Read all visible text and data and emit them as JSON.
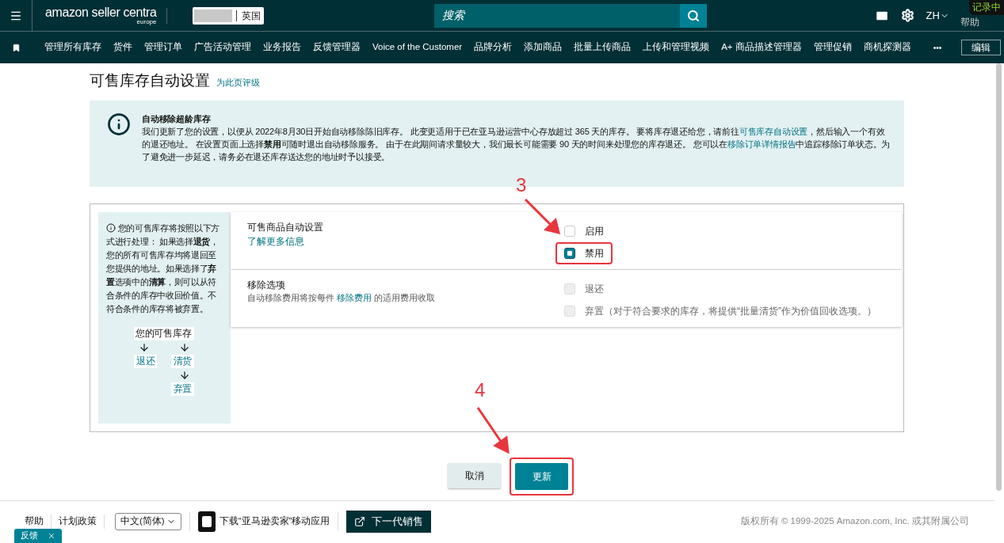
{
  "topbar": {
    "logo": {
      "name": "amazon seller centra",
      "region": "europe"
    },
    "marketplace": "英国",
    "search": {
      "placeholder": "搜索"
    },
    "language": "ZH",
    "help": "帮助",
    "recording_badge": "记录中"
  },
  "nav": {
    "items": [
      "管理所有库存",
      "货件",
      "管理订单",
      "广告活动管理",
      "业务报告",
      "反馈管理器",
      "Voice of the Customer",
      "品牌分析",
      "添加商品",
      "批量上传商品",
      "上传和管理视频",
      "A+ 商品描述管理器",
      "管理促销",
      "商机探测器"
    ],
    "more": "•••",
    "edit": "编辑"
  },
  "page": {
    "title": "可售库存自动设置",
    "rate_link": "为此页评级"
  },
  "banner": {
    "title": "自动移除超龄库存",
    "segments": [
      {
        "kind": "text",
        "text": "我们更新了您的设置，以便从 2022年8月30日开始自动移除陈旧库存。 此变更适用于已在亚马逊运营中心存放超过 365 天的库存。 要将库存退还给您，请前往"
      },
      {
        "kind": "link",
        "text": "可售库存自动设置"
      },
      {
        "kind": "text",
        "text": "，然后输入一个有效的退还地址。 在设置页面上选择**禁用**可随时退出自动移除服务。 由于在此期间请求量较大，我们最长可能需要 90 天的时间来处理您的库存退还。 您可以在"
      },
      {
        "kind": "link",
        "text": "移除订单详情报告"
      },
      {
        "kind": "text",
        "text": "中追踪移除订单状态。为了避免进一步延迟，请务必在退还库存送达您的地址时予以接受。"
      }
    ]
  },
  "explainer": {
    "text": "您的可售库存将按照以下方式进行处理： 如果选择**退货**，您的所有可售库存均将退回至您提供的地址。如果选择了**弃置**选项中的**清算**，则可以从符合条件的库存中收回价值。不符合条件的库存将被弃置。",
    "flow": {
      "root": "您的可售库存",
      "left": "退还",
      "right": "清货",
      "below": "弃置"
    }
  },
  "settings": [
    {
      "label": "可售商品自动设置",
      "link": "了解更多信息",
      "annotation": "3",
      "options": [
        {
          "label": "启用",
          "selected": false,
          "disabled": false,
          "highlighted": false
        },
        {
          "label": "禁用",
          "selected": true,
          "disabled": false,
          "highlighted": true
        }
      ]
    },
    {
      "label": "移除选项",
      "description_before": "自动移除费用将按每件 ",
      "description_link": "移除费用",
      "description_after": " 的适用费用收取",
      "options": [
        {
          "label": "退还",
          "selected": false,
          "disabled": true,
          "highlighted": false
        },
        {
          "label": "弃置（对于符合要求的库存，将提供“批量清货”作为价值回收选项。）",
          "selected": false,
          "disabled": true,
          "highlighted": false
        }
      ]
    }
  ],
  "actions": {
    "annotation": "4",
    "cancel": "取消",
    "update": {
      "label": "更新",
      "highlighted": true
    }
  },
  "footer": {
    "links": [
      "帮助",
      "计划政策"
    ],
    "language": "中文(简体)",
    "app": "下载“亚马逊卖家”移动应用",
    "next": "下一代销售",
    "copyright": "版权所有 © 1999-2025 Amazon.com, Inc. 或其附属公司",
    "feedback": "反馈"
  }
}
